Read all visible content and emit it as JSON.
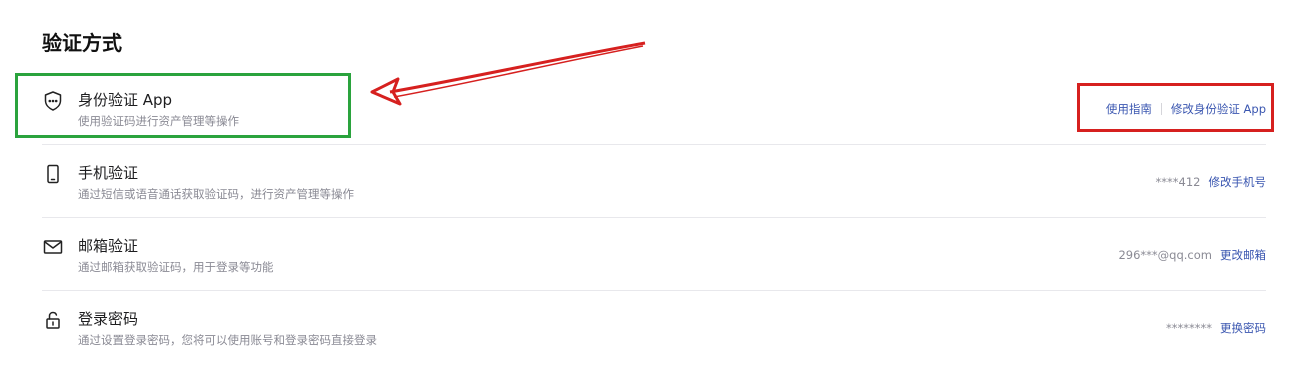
{
  "section": {
    "title": "验证方式"
  },
  "items": [
    {
      "icon": "shield-dots-icon",
      "title": "身份验证 App",
      "desc": "使用验证码进行资产管理等操作",
      "actions": [
        "使用指南",
        "修改身份验证 App"
      ]
    },
    {
      "icon": "phone-icon",
      "title": "手机验证",
      "desc": "通过短信或语音通话获取验证码，进行资产管理等操作",
      "masked": "****412",
      "action": "修改手机号"
    },
    {
      "icon": "mail-icon",
      "title": "邮箱验证",
      "desc": "通过邮箱获取验证码，用于登录等功能",
      "masked": "296***@qq.com",
      "action": "更改邮箱"
    },
    {
      "icon": "lock-icon",
      "title": "登录密码",
      "desc": "通过设置登录密码，您将可以使用账号和登录密码直接登录",
      "masked": "********",
      "action": "更换密码"
    }
  ],
  "annotations": {
    "green": "#2aa33d",
    "red": "#d6201f"
  }
}
